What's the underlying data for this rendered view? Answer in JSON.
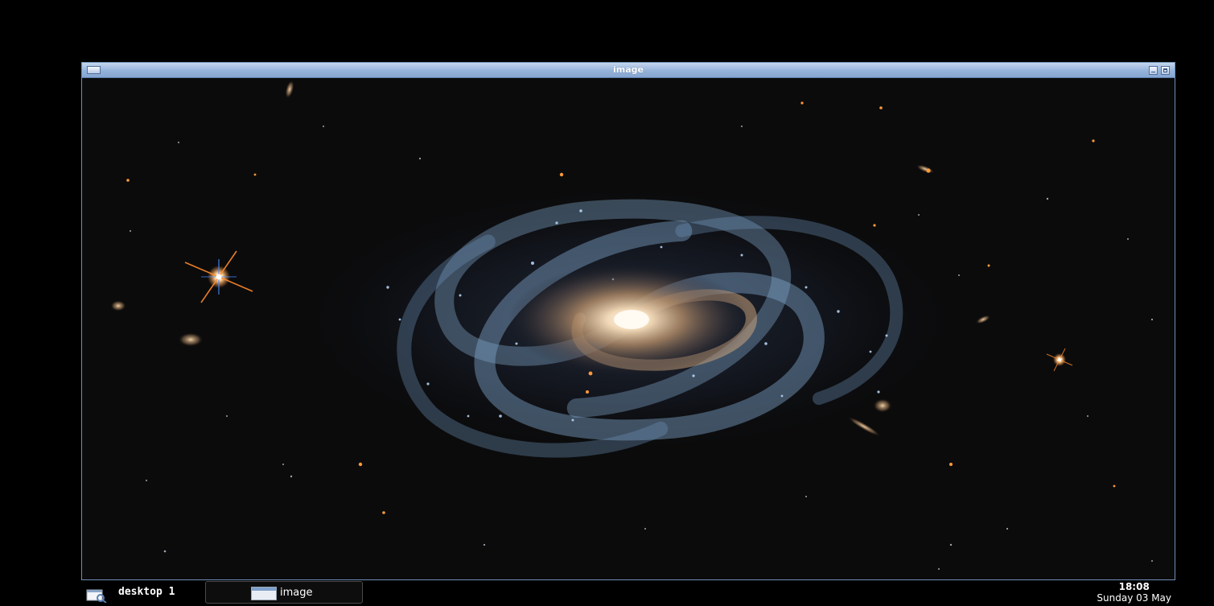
{
  "window": {
    "title": "image"
  },
  "viewer": {
    "content": "image"
  },
  "taskbar": {
    "desktop_label": "desktop 1",
    "desktop_icon": "desktop-switcher-icon",
    "task_label": "image",
    "task_icon": "image-window-icon",
    "clock_time": "18:08",
    "clock_date": "Sunday 03 May"
  },
  "colors": {
    "titlebar": "#94b2da",
    "background": "#000000",
    "text": "#ffffff"
  }
}
